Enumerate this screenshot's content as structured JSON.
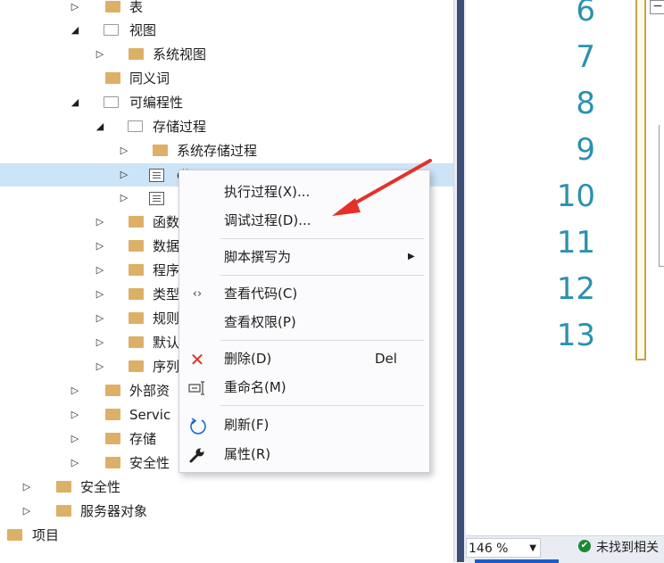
{
  "tree": {
    "items": [
      {
        "label": "表",
        "icon": "folder-icon",
        "arrow": "expand"
      },
      {
        "label": "视图",
        "icon": "folder-open-icon",
        "arrow": "collapse"
      },
      {
        "label": "系统视图",
        "icon": "folder-icon",
        "arrow": "expand"
      },
      {
        "label": "同义词",
        "icon": "folder-icon",
        "arrow": "none"
      },
      {
        "label": "可编程性",
        "icon": "folder-open-icon",
        "arrow": "collapse"
      },
      {
        "label": "存储过程",
        "icon": "folder-open-icon",
        "arrow": "collapse"
      },
      {
        "label": "系统存储过程",
        "icon": "folder-icon",
        "arrow": "expand"
      },
      {
        "label": "dbo.xxxxx",
        "icon": "procedure-icon",
        "arrow": "expand",
        "selected": true
      },
      {
        "label": "",
        "icon": "procedure-icon",
        "arrow": "expand"
      },
      {
        "label": "函数",
        "icon": "folder-icon",
        "arrow": "expand"
      },
      {
        "label": "数据",
        "icon": "folder-icon",
        "arrow": "expand"
      },
      {
        "label": "程序",
        "icon": "folder-icon",
        "arrow": "expand"
      },
      {
        "label": "类型",
        "icon": "folder-icon",
        "arrow": "expand"
      },
      {
        "label": "规则",
        "icon": "folder-icon",
        "arrow": "expand"
      },
      {
        "label": "默认",
        "icon": "folder-icon",
        "arrow": "expand"
      },
      {
        "label": "序列",
        "icon": "folder-icon",
        "arrow": "expand"
      },
      {
        "label": "外部资",
        "icon": "folder-icon",
        "arrow": "expand"
      },
      {
        "label": "Servic",
        "icon": "folder-icon",
        "arrow": "expand"
      },
      {
        "label": "存储",
        "icon": "folder-icon",
        "arrow": "expand"
      },
      {
        "label": "安全性",
        "icon": "folder-icon",
        "arrow": "expand"
      },
      {
        "label": "安全性",
        "icon": "folder-icon",
        "arrow": "expand"
      },
      {
        "label": "服务器对象",
        "icon": "folder-icon",
        "arrow": "expand"
      },
      {
        "label": "项目",
        "icon": "folder-icon",
        "arrow": "none"
      }
    ]
  },
  "context_menu": {
    "execute": "执行过程(X)...",
    "debug": "调试过程(D)...",
    "script_as": "脚本撰写为",
    "view_code": "查看代码(C)",
    "view_permissions": "查看权限(P)",
    "delete": "删除(D)",
    "delete_shortcut": "Del",
    "rename": "重命名(M)",
    "refresh": "刷新(F)",
    "properties": "属性(R)"
  },
  "editor": {
    "line_numbers": [
      "6",
      "7",
      "8",
      "9",
      "10",
      "11",
      "12",
      "13"
    ],
    "collapse_glyph": "−"
  },
  "status": {
    "zoom": "146 %",
    "message": "未找到相关"
  },
  "colors": {
    "selection": "#cce4f7",
    "folder": "#dcb067",
    "line_number": "#2b91af",
    "annotation_arrow": "#e3312a"
  }
}
